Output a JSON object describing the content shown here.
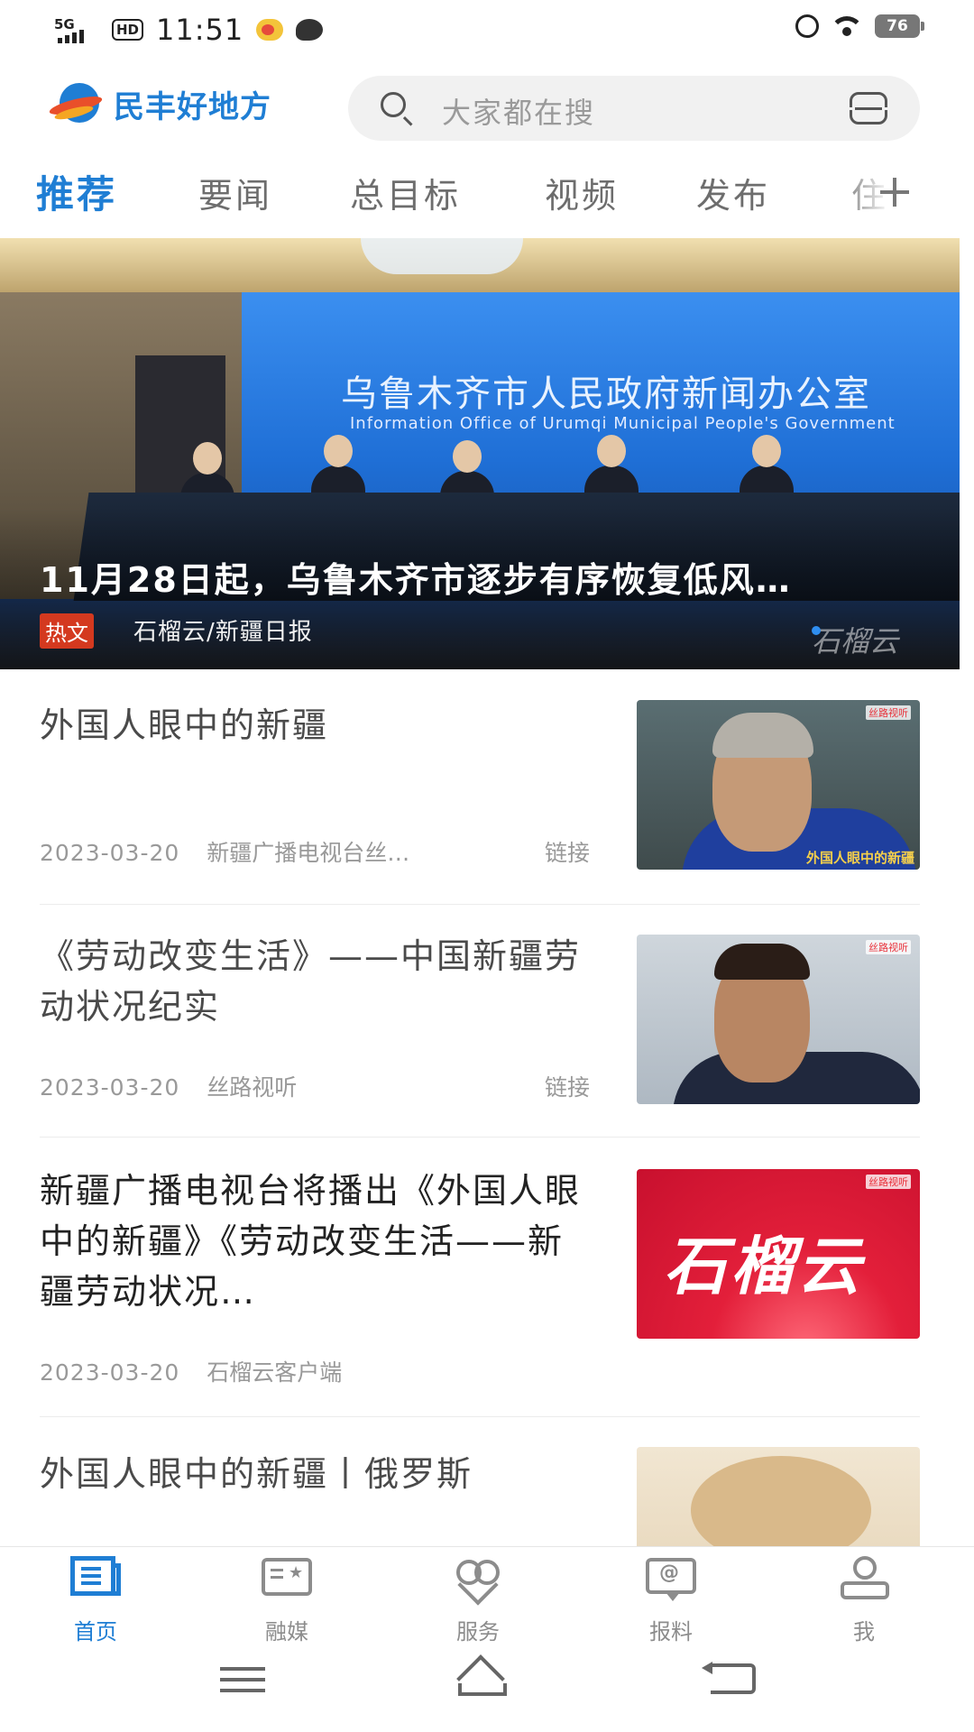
{
  "status_bar": {
    "network": "5G",
    "hd": "HD",
    "time": "11:51",
    "battery": "76"
  },
  "header": {
    "app_name": "民丰好地方",
    "search_placeholder": "大家都在搜"
  },
  "tabs": [
    {
      "label": "推荐",
      "active": true
    },
    {
      "label": "要闻",
      "active": false
    },
    {
      "label": "总目标",
      "active": false
    },
    {
      "label": "视频",
      "active": false
    },
    {
      "label": "发布",
      "active": false
    },
    {
      "label": "住",
      "active": false
    }
  ],
  "hero": {
    "title": "11月28日起，乌鲁木齐市逐步有序恢复低风…",
    "tag": "热文",
    "source": "石榴云/新疆日报",
    "screen_cn": "乌鲁木齐市人民政府新闻办公室",
    "screen_en": "Information Office of Urumqi Municipal People's Government",
    "watermark": "石榴云"
  },
  "news": [
    {
      "title": "外国人眼中的新疆",
      "date": "2023-03-20",
      "source": "新疆广播电视台丝…",
      "link": "链接"
    },
    {
      "title": "《劳动改变生活》——中国新疆劳动状况纪实",
      "date": "2023-03-20",
      "source": "丝路视听",
      "link": "链接"
    },
    {
      "title": "新疆广播电视台将播出《外国人眼中的新疆》《劳动改变生活——新疆劳动状况…",
      "date": "2023-03-20",
      "source": "石榴云客户端",
      "thumb_text": "石榴云"
    },
    {
      "title": "外国人眼中的新疆丨俄罗斯"
    }
  ],
  "thumb1_caption": "外国人眼中的新疆",
  "thumb_badge": "丝路视听",
  "bottom_nav": [
    {
      "label": "首页",
      "active": true
    },
    {
      "label": "融媒",
      "active": false
    },
    {
      "label": "服务",
      "active": false
    },
    {
      "label": "报料",
      "active": false
    },
    {
      "label": "我",
      "active": false
    }
  ],
  "colors": {
    "accent": "#1f7ed4",
    "tag_red": "#d4391f"
  }
}
